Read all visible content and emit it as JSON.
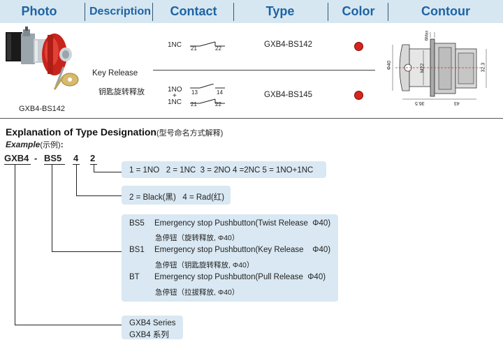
{
  "header": {
    "photo": "Photo",
    "description": "Description",
    "contact": "Contact",
    "type": "Type",
    "color": "Color",
    "contour": "Contour"
  },
  "product": {
    "photo_caption": "GXB4-BS142",
    "description_en": "Key Release",
    "description_cn": "钥匙旋转释放",
    "row1": {
      "contact": "1NC",
      "term_a": "21",
      "term_b": "22",
      "type": "GXB4-BS142",
      "color": "#d9231b"
    },
    "row2": {
      "contact_no": "1NO",
      "plus": "+",
      "contact_nc": "1NC",
      "no_a": "13",
      "no_b": "14",
      "nc_a": "21",
      "nc_b": "22",
      "type": "GXB4-BS145",
      "color": "#d9231b"
    },
    "contour": {
      "d1": "Φ40",
      "d2": "M22",
      "d3": "32.3",
      "d4": "6Max",
      "w1": "36.5",
      "w2": "43"
    }
  },
  "designation": {
    "title": "Explanation of Type Designation",
    "title_cn": "(型号命名方式解释)",
    "example_label": "Example",
    "example_cn": "(示例)",
    "colon": ":",
    "code_gxb4": "GXB4",
    "dash": "-",
    "code_bs5": "BS5",
    "code_4": "4",
    "code_2": "2",
    "box1": "1 = 1NO   2 = 1NC  3 = 2NO 4 =2NC 5 = 1NO+1NC",
    "box2": "2 = Black(黑)   4 = Rad(红)",
    "box3": [
      {
        "code": "BS5",
        "en": "Emergency stop Pushbutton(Twist Release  Φ40)",
        "cn": "急停钮（旋转释放, Φ40）"
      },
      {
        "code": "BS1",
        "en": "Emergency stop Pushbutton(Key Release    Φ40)",
        "cn": "急停钮（钥匙旋转释放, Φ40）"
      },
      {
        "code": "BT",
        "en": "Emergency stop Pushbutton(Pull Release  Φ40)",
        "cn": "急停钮（拉拔释放, Φ40）"
      }
    ],
    "box4_en": "GXB4 Series",
    "box4_cn": "GXB4 系列"
  }
}
